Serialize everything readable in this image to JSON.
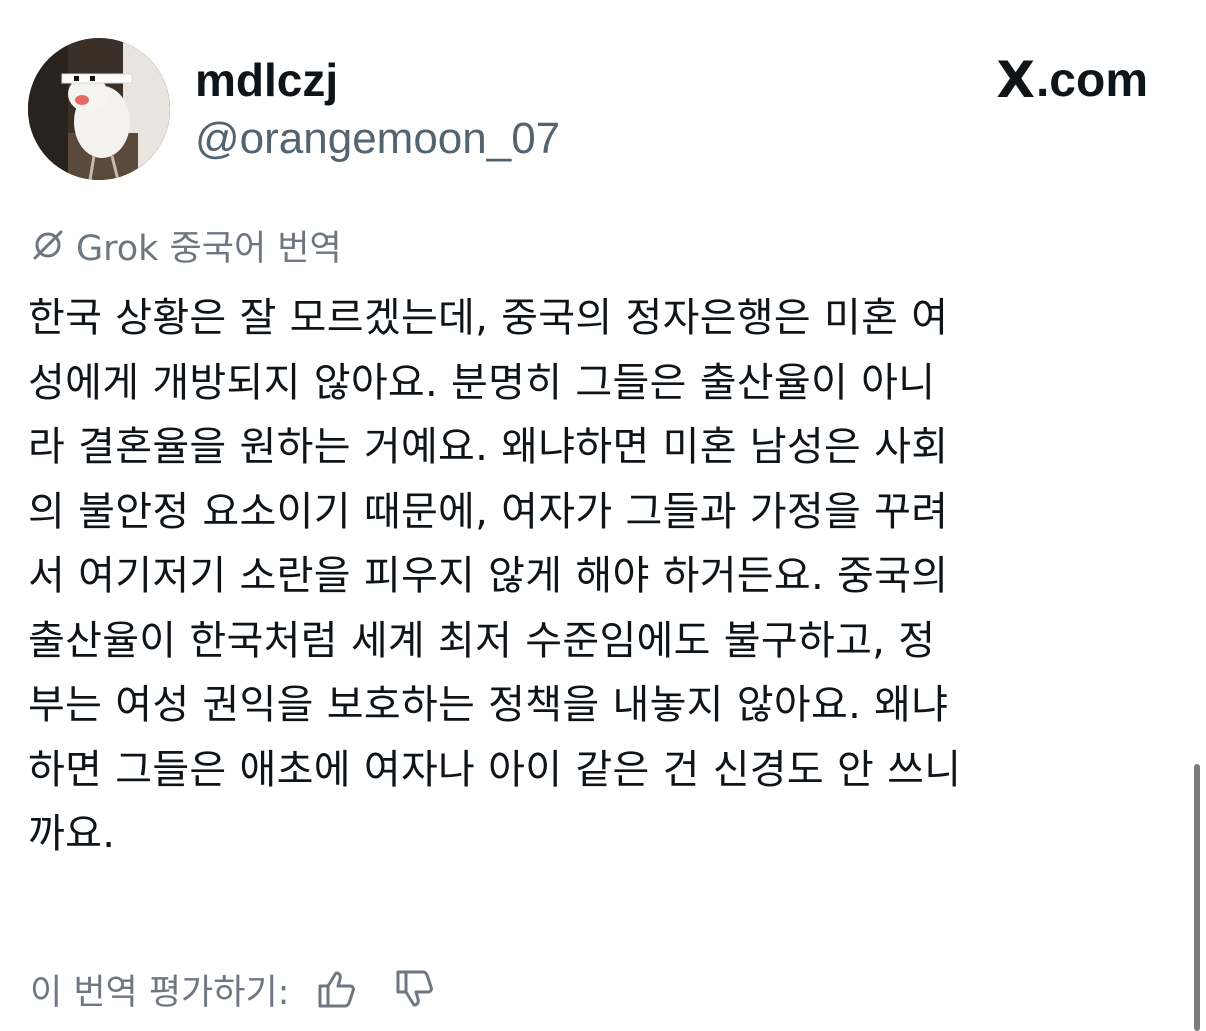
{
  "tweet": {
    "display_name": "mdlczj",
    "handle": "@orangemoon_07",
    "site_brand": "X",
    "site_suffix": ".com",
    "avatar_icon": "bird-avatar-icon"
  },
  "translation": {
    "label": "Grok 중국어 번역",
    "icon": "grok-logo-icon",
    "text": "한국 상황은 잘 모르겠는데, 중국의 정자은행은 미혼 여\n성에게 개방되지 않아요. 분명히 그들은 출산율이 아니\n라 결혼율을 원하는 거예요. 왜냐하면 미혼 남성은 사회\n의 불안정 요소이기 때문에, 여자가 그들과 가정을 꾸려\n서 여기저기 소란을 피우지 않게 해야 하거든요. 중국의\n출산율이 한국처럼 세계 최저 수준임에도 불구하고, 정\n부는 여성 권익을 보호하는 정책을 내놓지 않아요. 왜냐\n하면 그들은 애초에 여자나 아이 같은 건 신경도 안 쓰니\n까요."
  },
  "rating": {
    "label": "이 번역 평가하기:",
    "thumbs_up_icon": "thumbs-up-icon",
    "thumbs_down_icon": "thumbs-down-icon"
  },
  "colors": {
    "text_primary": "#0f1419",
    "text_secondary": "#536471",
    "muted": "#6e7681",
    "background": "#ffffff"
  }
}
